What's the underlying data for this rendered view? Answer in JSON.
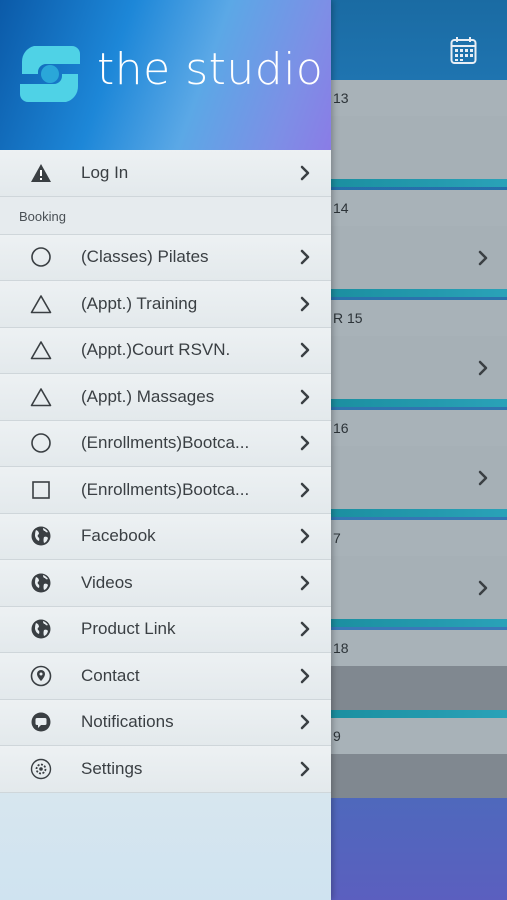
{
  "app": {
    "logo_text": "the studio"
  },
  "background": {
    "calendar_icon": "calendar-icon",
    "days": [
      {
        "label": "13",
        "dark_body": false,
        "has_chevron": false
      },
      {
        "label": "14",
        "dark_body": false,
        "has_chevron": true
      },
      {
        "label": "R 15",
        "dark_body": false,
        "has_chevron": true
      },
      {
        "label": "16",
        "dark_body": false,
        "has_chevron": true
      },
      {
        "label": "7",
        "dark_body": false,
        "has_chevron": true
      },
      {
        "label": "18",
        "dark_body": true,
        "has_chevron": false
      },
      {
        "label": "9",
        "dark_body": true,
        "has_chevron": false
      }
    ]
  },
  "menu": {
    "login": {
      "label": "Log In",
      "icon": "warning-icon"
    },
    "section_booking": "Booking",
    "items": [
      {
        "label": "(Classes) Pilates",
        "icon": "circle-icon"
      },
      {
        "label": "(Appt.) Training",
        "icon": "triangle-icon"
      },
      {
        "label": "(Appt.)Court RSVN.",
        "icon": "triangle-icon"
      },
      {
        "label": "(Appt.) Massages",
        "icon": "triangle-icon"
      },
      {
        "label": "(Enrollments)Bootca...",
        "icon": "circle-icon"
      },
      {
        "label": "(Enrollments)Bootca...",
        "icon": "square-icon"
      },
      {
        "label": "Facebook",
        "icon": "globe-icon"
      },
      {
        "label": "Videos",
        "icon": "globe-icon"
      },
      {
        "label": "Product Link",
        "icon": "globe-icon"
      },
      {
        "label": "Contact",
        "icon": "location-pin-icon"
      },
      {
        "label": "Notifications",
        "icon": "chat-bubble-icon"
      },
      {
        "label": "Settings",
        "icon": "gear-icon"
      }
    ]
  },
  "colors": {
    "accent": "#1d87d8",
    "header_gradient_end": "#8a7ce6",
    "text": "#3a3f43"
  }
}
